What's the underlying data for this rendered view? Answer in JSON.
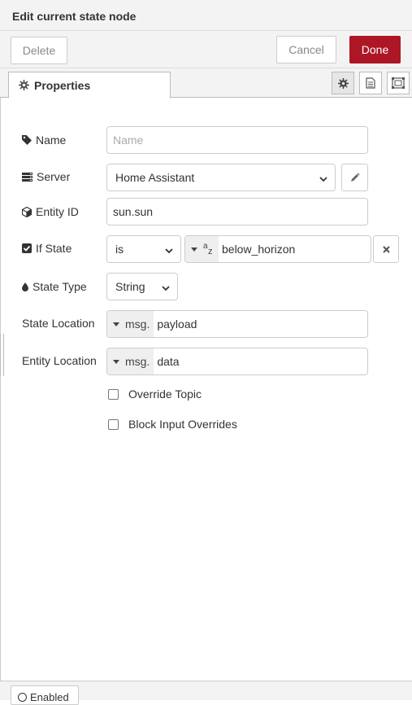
{
  "tray": {
    "title": "Edit current state node"
  },
  "toolbar": {
    "delete_label": "Delete",
    "cancel_label": "Cancel",
    "done_label": "Done"
  },
  "tabs": {
    "properties_label": "Properties",
    "icons": [
      "gear-icon",
      "description-icon",
      "appearance-icon"
    ]
  },
  "form": {
    "name": {
      "label": "Name",
      "value": "",
      "placeholder": "Name"
    },
    "server": {
      "label": "Server",
      "value": "Home Assistant"
    },
    "entity_id": {
      "label": "Entity ID",
      "value": "sun.sun"
    },
    "if_state": {
      "label": "If State",
      "operator": "is",
      "value": "below_horizon"
    },
    "state_type": {
      "label": "State Type",
      "value": "String"
    },
    "state_location": {
      "label": "State Location",
      "prefix": "msg.",
      "value": "payload"
    },
    "entity_location": {
      "label": "Entity Location",
      "prefix": "msg.",
      "value": "data"
    },
    "override_topic": {
      "label": "Override Topic",
      "checked": false
    },
    "block_input_overrides": {
      "label": "Block Input Overrides",
      "checked": false
    }
  },
  "footer": {
    "enabled_label": "Enabled"
  },
  "colors": {
    "done_button": "#ad1625",
    "toolbar_bg": "#f3f3f3"
  }
}
